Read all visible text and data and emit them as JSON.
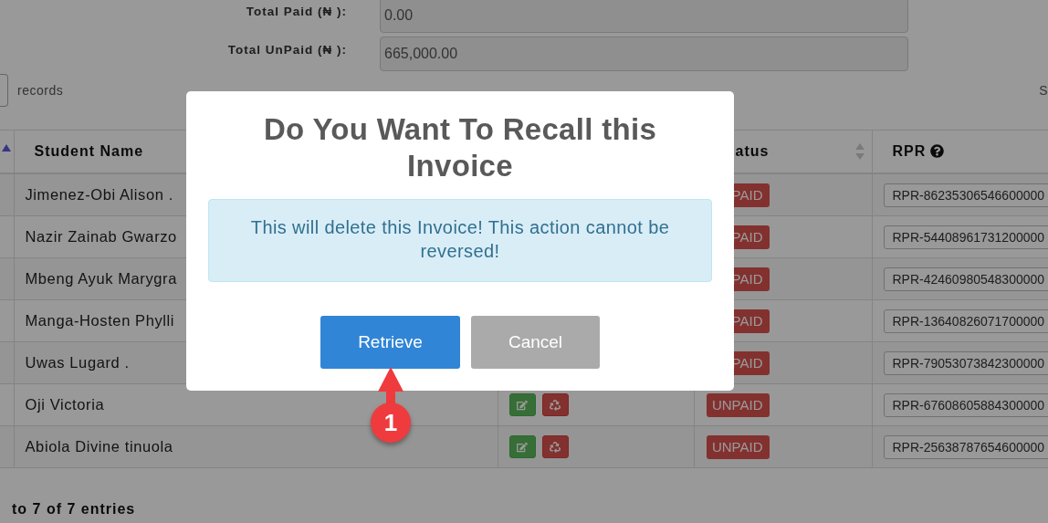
{
  "totals": [
    {
      "label": "Total Paid (₦ ):",
      "value": "0.00"
    },
    {
      "label": "Total UnPaid (₦ ):",
      "value": "665,000.00"
    }
  ],
  "length_menu": {
    "label": "records"
  },
  "search": {
    "label": "S"
  },
  "table": {
    "columns": [
      {
        "kind": "sorted"
      },
      {
        "kind": "text",
        "label": "Student Name"
      },
      {
        "kind": "blank"
      },
      {
        "kind": "text",
        "label": "atus",
        "sortable": true
      },
      {
        "kind": "text",
        "label": "RPR",
        "help": true
      }
    ],
    "rows": [
      {
        "name": "Jimenez-Obi Alison .",
        "status": "PAID",
        "rpr": "RPR-86235306546600000"
      },
      {
        "name": "Nazir Zainab Gwarzo",
        "status": "PAID",
        "rpr": "RPR-54408961731200000"
      },
      {
        "name": "Mbeng Ayuk Marygra",
        "status": "PAID",
        "rpr": "RPR-42460980548300000"
      },
      {
        "name": "Manga-Hosten Phylli",
        "status": "PAID",
        "rpr": "RPR-13640826071700000"
      },
      {
        "name": "Uwas Lugard .",
        "status": "PAID",
        "rpr": "RPR-79053073842300000"
      },
      {
        "name": "Oji Victoria",
        "actions": true,
        "status": "UNPAID",
        "rpr": "RPR-67608605884300000"
      },
      {
        "name": "Abiola Divine tinuola",
        "actions": true,
        "status": "UNPAID",
        "rpr": "RPR-25638787654600000"
      }
    ]
  },
  "footer": {
    "info": "to 7 of 7 entries"
  },
  "modal": {
    "title": "Do You Want To Recall this Invoice",
    "message": "This will delete this Invoice! This action cannot be reversed!",
    "buttons": [
      {
        "label": "Retrieve",
        "kind": "primary"
      },
      {
        "label": "Cancel",
        "kind": "secondary"
      }
    ]
  },
  "annotation": {
    "label": "1"
  }
}
